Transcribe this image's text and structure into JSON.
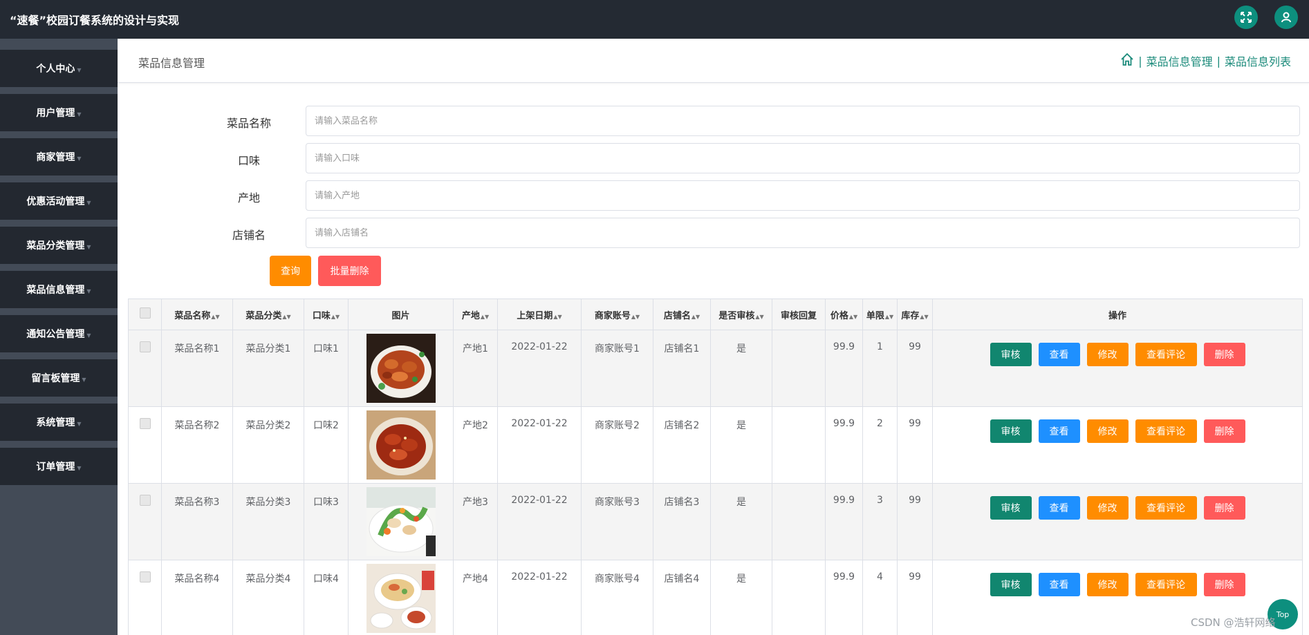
{
  "app": {
    "title": "“速餐”校园订餐系统的设计与实现"
  },
  "topbar": {
    "fullscreen_icon": "fullscreen-icon",
    "user_icon": "user-icon",
    "accent": "#0d8f7e"
  },
  "sidebar": {
    "items": [
      {
        "label": "个人中心"
      },
      {
        "label": "用户管理"
      },
      {
        "label": "商家管理"
      },
      {
        "label": "优惠活动管理"
      },
      {
        "label": "菜品分类管理"
      },
      {
        "label": "菜品信息管理"
      },
      {
        "label": "通知公告管理"
      },
      {
        "label": "留言板管理"
      },
      {
        "label": "系统管理"
      },
      {
        "label": "订单管理"
      }
    ]
  },
  "header": {
    "page_title": "菜品信息管理",
    "breadcrumb": [
      "菜品信息管理",
      "菜品信息列表"
    ],
    "separator": "|"
  },
  "search": {
    "fields": [
      {
        "label": "菜品名称",
        "placeholder": "请输入菜品名称"
      },
      {
        "label": "口味",
        "placeholder": "请输入口味"
      },
      {
        "label": "产地",
        "placeholder": "请输入产地"
      },
      {
        "label": "店铺名",
        "placeholder": "请输入店铺名"
      }
    ],
    "query_label": "查询",
    "batch_delete_label": "批量删除"
  },
  "table": {
    "headers": [
      "菜品名称",
      "菜品分类",
      "口味",
      "图片",
      "产地",
      "上架日期",
      "商家账号",
      "店铺名",
      "是否审核",
      "审核回复",
      "价格",
      "单限",
      "库存",
      "操作"
    ],
    "actions": [
      "审核",
      "查看",
      "修改",
      "查看评论",
      "删除"
    ],
    "rows": [
      {
        "name": "菜品名称1",
        "category": "菜品分类1",
        "taste": "口味1",
        "origin": "产地1",
        "date": "2022-01-22",
        "merchant": "商家账号1",
        "shop": "店铺名1",
        "audited": "是",
        "reply": "",
        "price": "99.9",
        "limit": "1",
        "stock": "99"
      },
      {
        "name": "菜品名称2",
        "category": "菜品分类2",
        "taste": "口味2",
        "origin": "产地2",
        "date": "2022-01-22",
        "merchant": "商家账号2",
        "shop": "店铺名2",
        "audited": "是",
        "reply": "",
        "price": "99.9",
        "limit": "2",
        "stock": "99"
      },
      {
        "name": "菜品名称3",
        "category": "菜品分类3",
        "taste": "口味3",
        "origin": "产地3",
        "date": "2022-01-22",
        "merchant": "商家账号3",
        "shop": "店铺名3",
        "audited": "是",
        "reply": "",
        "price": "99.9",
        "limit": "3",
        "stock": "99"
      },
      {
        "name": "菜品名称4",
        "category": "菜品分类4",
        "taste": "口味4",
        "origin": "产地4",
        "date": "2022-01-22",
        "merchant": "商家账号4",
        "shop": "店铺名4",
        "audited": "是",
        "reply": "",
        "price": "99.9",
        "limit": "4",
        "stock": "99"
      }
    ]
  },
  "footer": {
    "top_label": "Top",
    "watermark": "CSDN @浩轩网络"
  },
  "colors": {
    "audit": "#11866f",
    "view": "#1e90ff",
    "edit": "#ff8c00",
    "comments": "#ff8c00",
    "delete": "#ff5a5a",
    "query": "#ff8c00",
    "batch_delete": "#ff5a5a"
  }
}
